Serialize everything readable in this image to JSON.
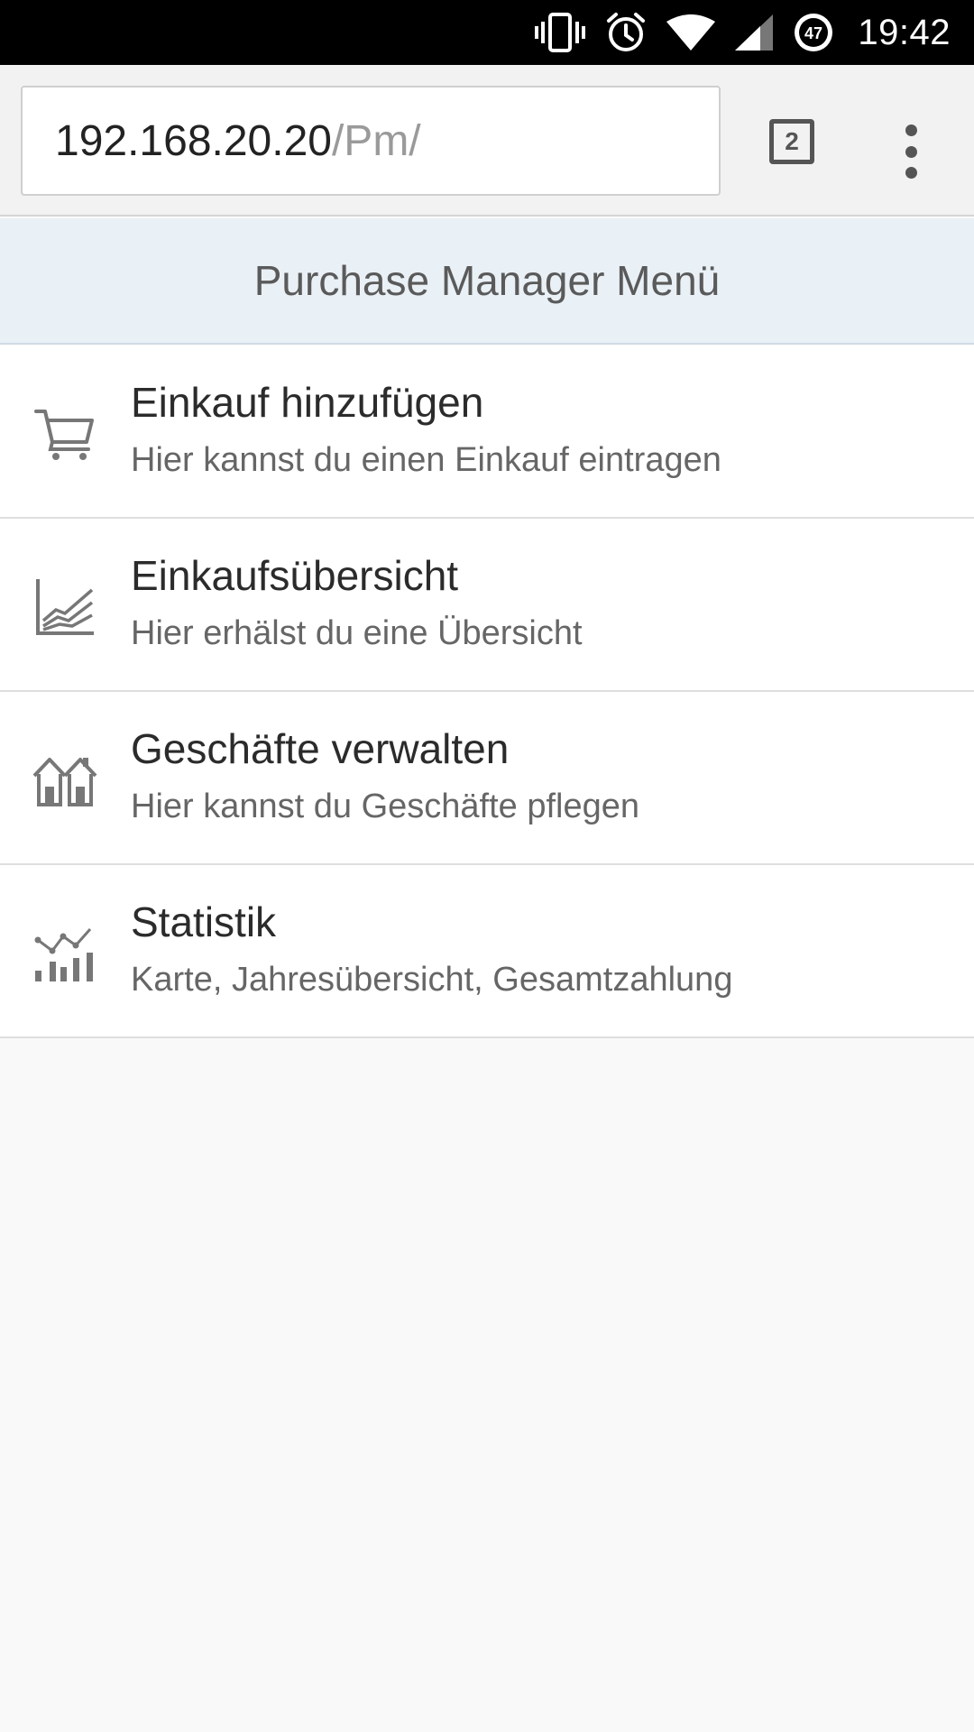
{
  "status_bar": {
    "time": "19:42",
    "notification_badge": "47",
    "icons": [
      "vibrate-icon",
      "alarm-icon",
      "wifi-icon",
      "cell-signal-icon",
      "notification-badge-icon"
    ]
  },
  "browser": {
    "url_host": "192.168.20.20",
    "url_path": "/Pm/",
    "tab_count": "2",
    "menu_icon": "overflow-menu-icon"
  },
  "page": {
    "title": "Purchase Manager Menü"
  },
  "menu": {
    "items": [
      {
        "title": "Einkauf hinzufügen",
        "subtitle": "Hier kannst du einen Einkauf eintragen",
        "icon": "shopping-cart-icon"
      },
      {
        "title": "Einkaufsübersicht",
        "subtitle": "Hier erhälst du eine Übersicht",
        "icon": "area-chart-icon"
      },
      {
        "title": "Geschäfte verwalten",
        "subtitle": "Hier kannst du Geschäfte pflegen",
        "icon": "houses-icon"
      },
      {
        "title": "Statistik",
        "subtitle": "Karte, Jahresübersicht, Gesamtzahlung",
        "icon": "statistics-icon"
      }
    ]
  },
  "colors": {
    "header_bg": "#e9f0f6",
    "icon_gray": "#777777",
    "status_bar_bg": "#000000"
  }
}
